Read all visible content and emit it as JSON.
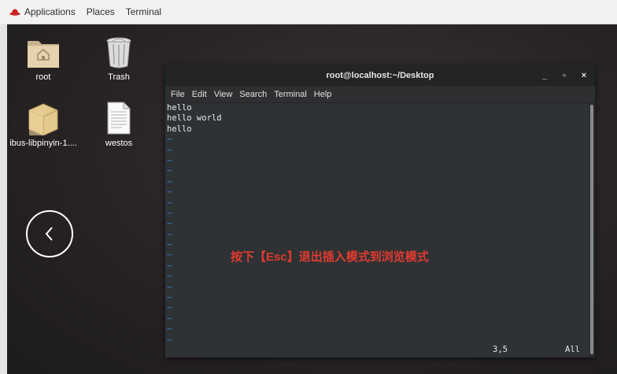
{
  "topbar": {
    "applications": "Applications",
    "places": "Places",
    "terminal": "Terminal",
    "logo_icon": "redhat-icon"
  },
  "desktop": {
    "icons": [
      {
        "label": "root",
        "icon": "home-folder-icon"
      },
      {
        "label": "Trash",
        "icon": "trash-icon"
      },
      {
        "label": "ibus-libpinyin-1....",
        "icon": "package-icon"
      },
      {
        "label": "westos",
        "icon": "text-file-icon"
      }
    ],
    "back_icon": "chevron-left-icon"
  },
  "terminal": {
    "title": "root@localhost:~/Desktop",
    "minimize": "_",
    "maximize": "▫",
    "close": "×",
    "menu": [
      "File",
      "Edit",
      "View",
      "Search",
      "Terminal",
      "Help"
    ],
    "lines": [
      "hello",
      "hello world",
      "hello"
    ],
    "tilde": "~",
    "status_position": "3,5",
    "status_scroll": "All",
    "tilde_color": "#3c7fd6"
  },
  "annotation": "按下【Esc】退出插入模式到浏览模式",
  "colors": {
    "annotation": "#e23a2e",
    "terminal_bg": "#2f3235",
    "topbar_bg": "#f2f2f2"
  }
}
